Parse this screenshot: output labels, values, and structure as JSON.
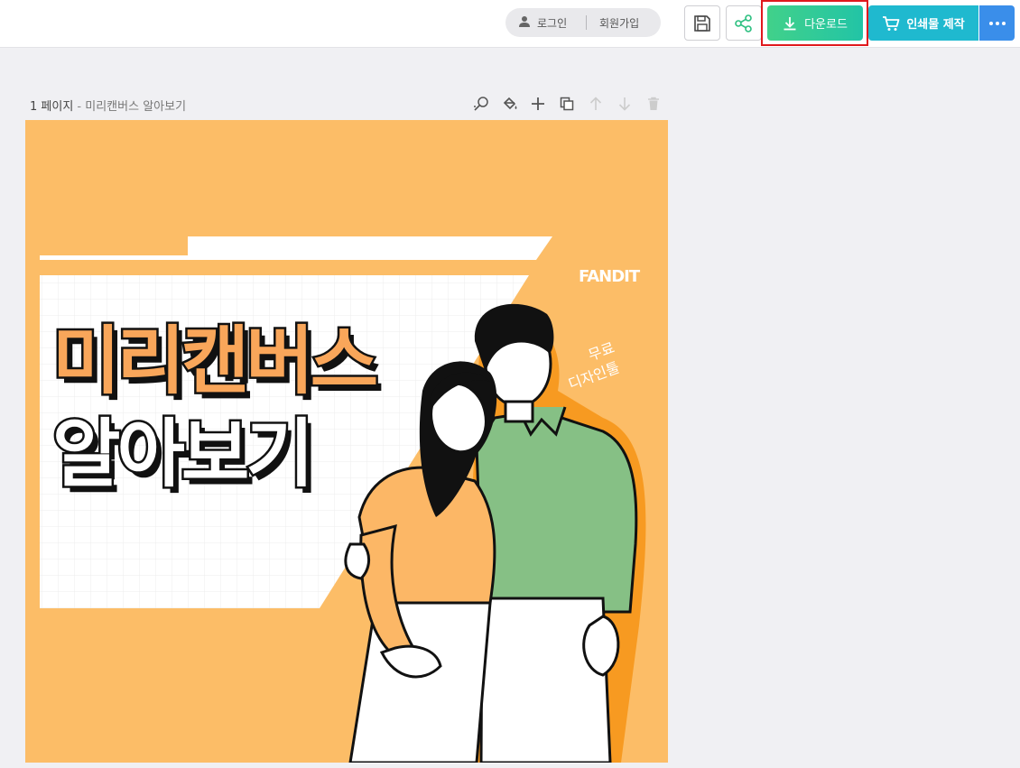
{
  "header": {
    "login_label": "로그인",
    "signup_label": "회원가입",
    "download_label": "다운로드",
    "print_label": "인쇄물 제작"
  },
  "page": {
    "number_label": "1 페이지",
    "separator": " - ",
    "title": "미리캔버스 알아보기"
  },
  "canvas": {
    "title_line1": "미리캔버스",
    "title_line2": "알아보기",
    "brand": "FANDIT",
    "script_line1": "무료",
    "script_line2": "디자인툴",
    "background_color": "#fcbd67"
  },
  "colors": {
    "download_gradient": [
      "#41d18a",
      "#22c4a6"
    ],
    "print": "#1fb9cf",
    "more": "#3a8eea",
    "highlight": "#e0191d"
  }
}
